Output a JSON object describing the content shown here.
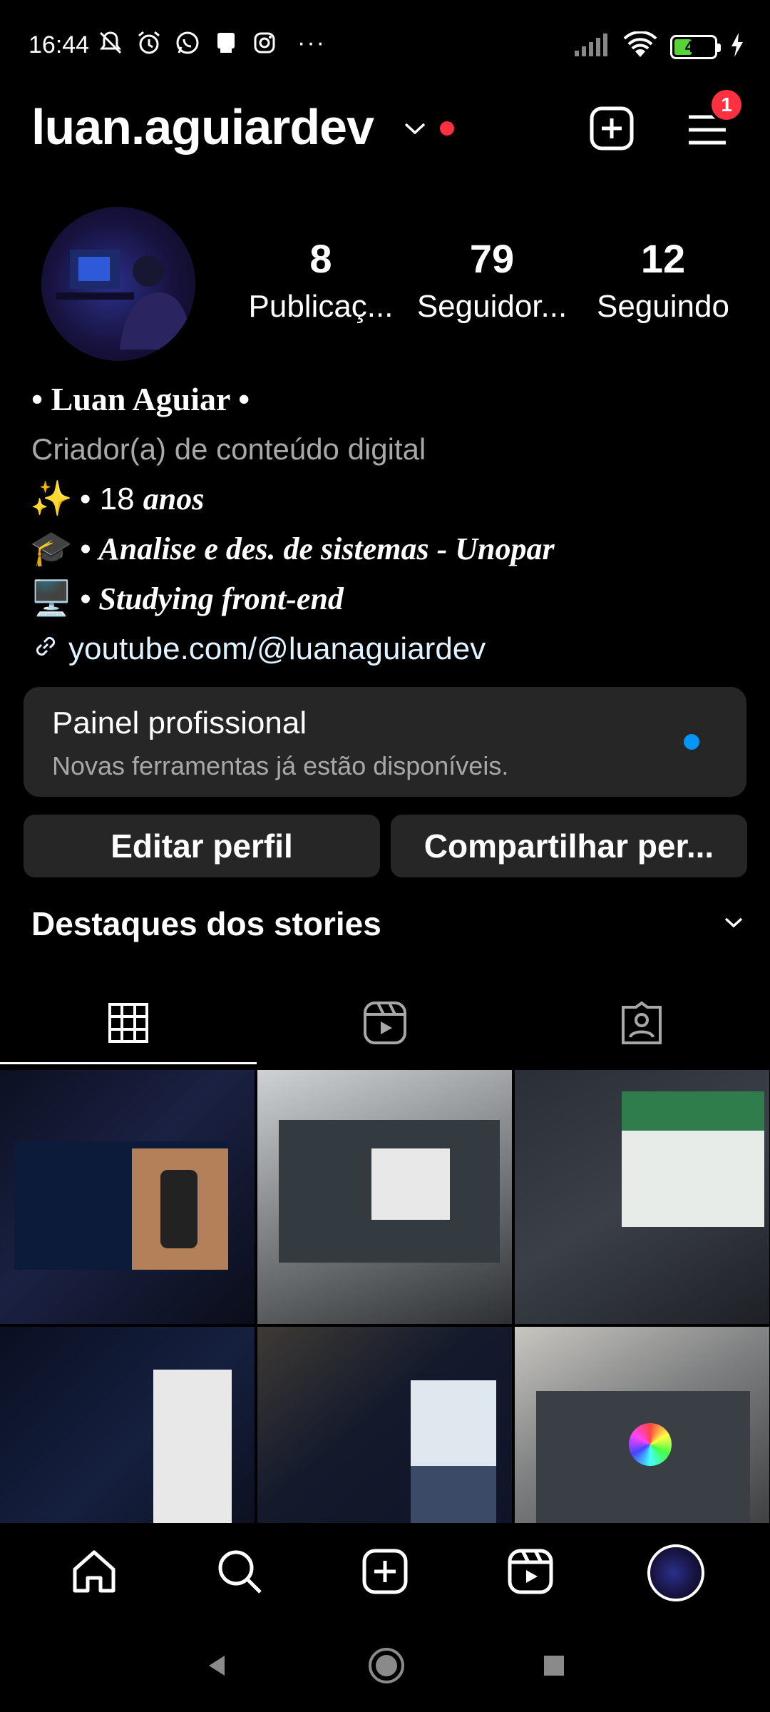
{
  "status_bar": {
    "time": "16:44",
    "battery_level": "40",
    "left_icons": [
      "mute-icon",
      "alarm-icon",
      "whatsapp-icon",
      "system-icon",
      "instagram-icon"
    ],
    "overflow": "···"
  },
  "header": {
    "username": "luan.aguiardev",
    "menu_badge": "1"
  },
  "profile": {
    "stats": [
      {
        "count": "8",
        "label": "Publicaç..."
      },
      {
        "count": "79",
        "label": "Seguidor..."
      },
      {
        "count": "12",
        "label": "Seguindo"
      }
    ],
    "name": "• Luan Aguiar •",
    "category": "Criador(a) de conteúdo digital",
    "bio_lines": [
      {
        "emoji": "✨",
        "prefix": "• 18 ",
        "text": "anos"
      },
      {
        "emoji": "🎓",
        "prefix": "• ",
        "text": "Analise e des. de sistemas - Unopar"
      },
      {
        "emoji": "🖥️",
        "prefix": "• ",
        "text": "Studying front-end"
      }
    ],
    "link": "youtube.com/@luanaguiardev"
  },
  "professional_panel": {
    "title": "Painel profissional",
    "subtitle": "Novas ferramentas já estão disponíveis."
  },
  "actions": {
    "edit": "Editar perfil",
    "share": "Compartilhar per..."
  },
  "highlights": {
    "title": "Destaques dos stories"
  },
  "tabs": [
    "grid-icon",
    "reels-icon",
    "tagged-icon"
  ],
  "colors": {
    "background": "#000000",
    "card": "#262626",
    "secondary_text": "#a8a8a8",
    "badge": "#ff3040",
    "accent_blue": "#0095f6"
  }
}
